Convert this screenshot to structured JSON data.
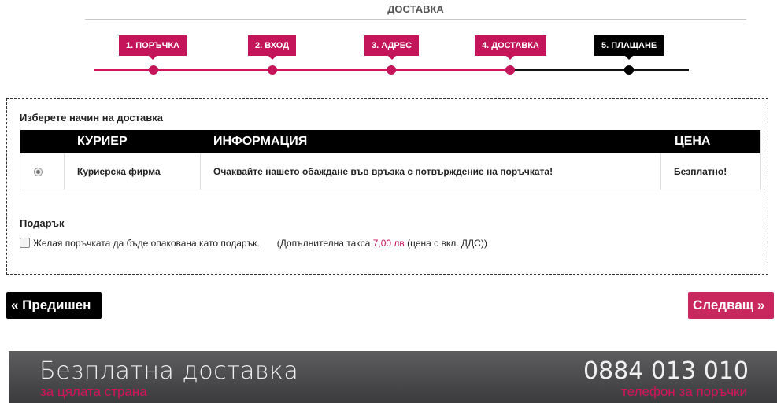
{
  "page": {
    "heading": "ДОСТАВКА"
  },
  "steps": [
    {
      "label": "1. ПОРЪЧКА",
      "state": "done"
    },
    {
      "label": "2. ВХОД",
      "state": "done"
    },
    {
      "label": "3. АДРЕС",
      "state": "done"
    },
    {
      "label": "4. ДОСТАВКА",
      "state": "done"
    },
    {
      "label": "5. ПЛАЩАНЕ",
      "state": "current"
    }
  ],
  "delivery": {
    "title": "Изберете начин на доставка",
    "columns": {
      "courier": "КУРИЕР",
      "info": "ИНФОРМАЦИЯ",
      "price": "ЦЕНА"
    },
    "options": [
      {
        "selected": true,
        "courier": "Куриерска фирма",
        "info": "Очаквайте нашето обаждане във връзка с потвърждение на поръчката!",
        "price": "Безплатно!"
      }
    ]
  },
  "gift": {
    "title": "Подарък",
    "checked": false,
    "checkbox_label": "Желая поръчката да бъде опакована като подарък.",
    "fee_prefix": "(Допълнителна такса",
    "fee_amount": "7,00 лв",
    "fee_suffix": "(цена с вкл. ДДС))"
  },
  "navigation": {
    "prev_label": "« Предишен",
    "next_label": "Следващ »"
  },
  "banner": {
    "title": "Безплатна доставка",
    "subtitle": "за цялата страна",
    "phone": "0884 013 010",
    "phone_caption": "телефон за поръчки"
  },
  "colors": {
    "accent": "#c4145a",
    "dark": "#000000",
    "banner_bg": "#4a4a4c"
  }
}
